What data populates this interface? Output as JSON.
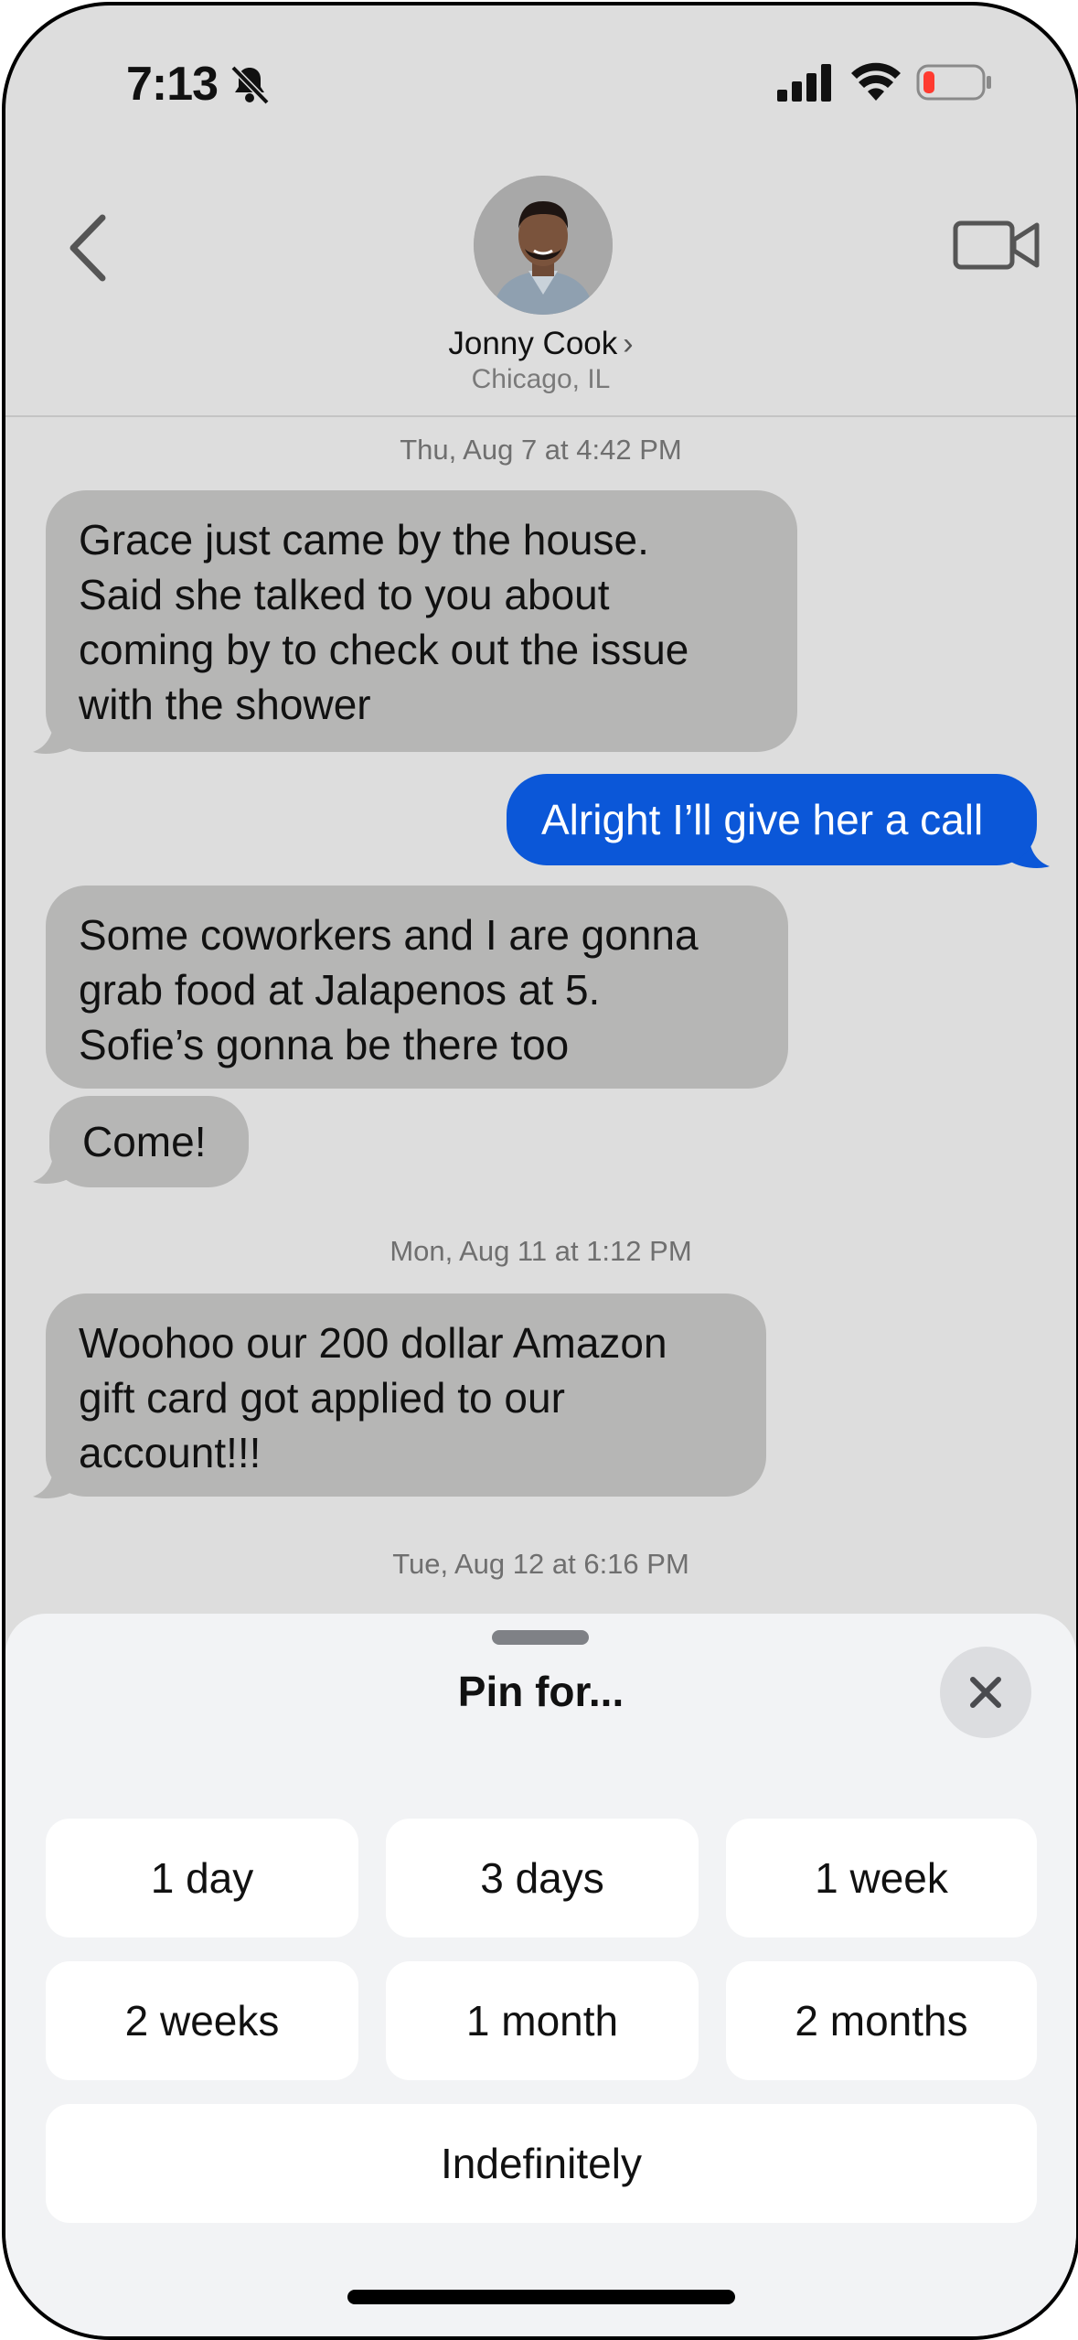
{
  "status": {
    "time": "7:13"
  },
  "header": {
    "contact_name": "Jonny Cook",
    "contact_chevron": "›",
    "contact_location": "Chicago, IL"
  },
  "messages": [
    {
      "type": "timestamp",
      "text": "Thu, Aug 7 at 4:42 PM"
    },
    {
      "type": "incoming",
      "lines": [
        "Grace just came by the house.",
        "Said she talked to you about",
        "coming by to check out the issue",
        "with the shower"
      ]
    },
    {
      "type": "outgoing",
      "lines": [
        "Alright I’ll give her a call"
      ]
    },
    {
      "type": "incoming",
      "lines": [
        "Some coworkers and I are gonna",
        "grab food at Jalapenos at 5.",
        "Sofie’s gonna be there too"
      ]
    },
    {
      "type": "incoming",
      "lines": [
        "Come!"
      ]
    },
    {
      "type": "timestamp",
      "text": "Mon, Aug 11 at 1:12 PM"
    },
    {
      "type": "incoming",
      "lines": [
        "Woohoo our 200 dollar Amazon",
        "gift card got applied to our",
        "account!!!"
      ]
    },
    {
      "type": "timestamp",
      "text": "Tue, Aug 12 at 6:16 PM"
    }
  ],
  "sheet": {
    "title": "Pin for...",
    "close_icon": "×",
    "options": [
      "1 day",
      "3 days",
      "1 week",
      "2 weeks",
      "1 month",
      "2 months",
      "Indefinitely"
    ]
  },
  "colors": {
    "background": "#dddddd",
    "incoming_bubble": "#b6b6b5",
    "outgoing_bubble": "#0b57d8",
    "sheet": "#f2f3f5",
    "battery_low": "#ff3b30"
  },
  "icons": {
    "back": "chevron-left-icon",
    "video": "video-camera-icon",
    "bell": "bell-slash-icon",
    "signal": "cellular-signal-icon",
    "wifi": "wifi-icon",
    "battery": "battery-low-icon",
    "close": "close-icon"
  }
}
